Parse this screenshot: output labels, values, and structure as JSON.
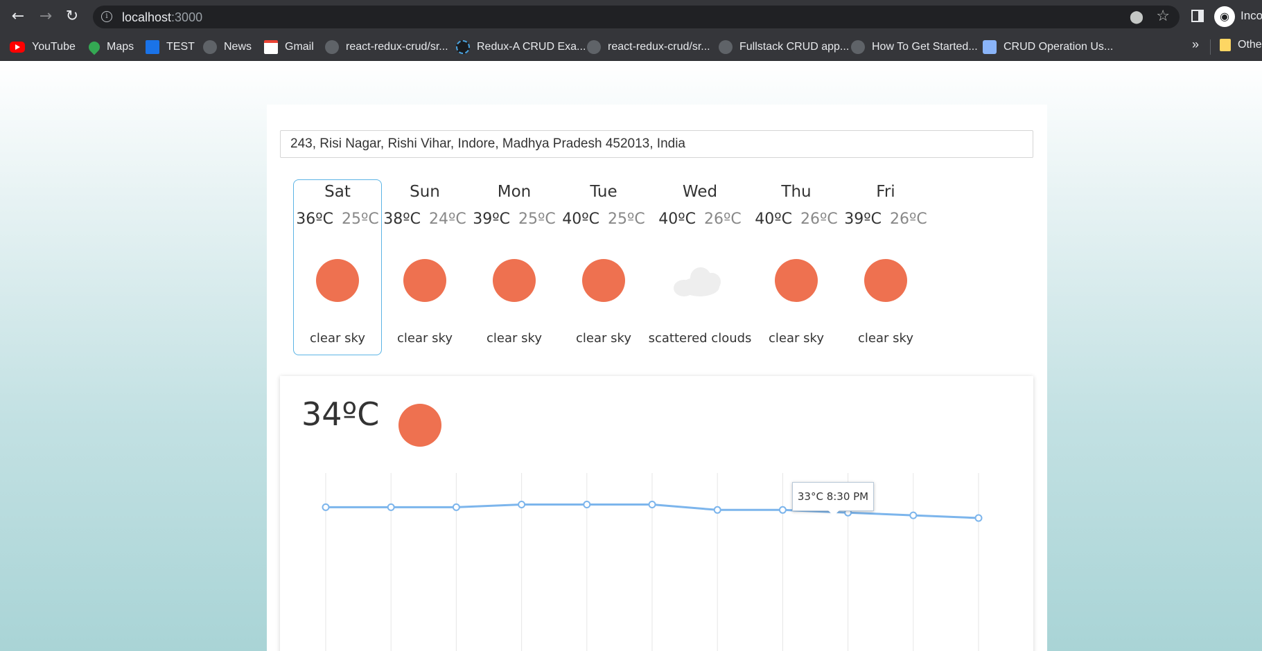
{
  "browser": {
    "url_host": "localhost",
    "url_port": ":3000",
    "profile_label": "Incognito",
    "bookmarks": [
      {
        "label": "YouTube",
        "icon": "youtube-icon"
      },
      {
        "label": "Maps",
        "icon": "maps-icon"
      },
      {
        "label": "TEST",
        "icon": "sxm-icon"
      },
      {
        "label": "News",
        "icon": "globe-icon"
      },
      {
        "label": "Gmail",
        "icon": "gmail-icon"
      },
      {
        "label": "react-redux-crud/sr...",
        "icon": "globe-icon"
      },
      {
        "label": "Redux-A CRUD Exa...",
        "icon": "redux-icon"
      },
      {
        "label": "react-redux-crud/sr...",
        "icon": "globe-icon"
      },
      {
        "label": "Fullstack CRUD app...",
        "icon": "globe-icon"
      },
      {
        "label": "How To Get Started...",
        "icon": "globe-icon"
      },
      {
        "label": "CRUD Operation Us...",
        "icon": "crud-icon"
      }
    ],
    "overflow_label": "»",
    "other_folder_label": "Other bookmarks"
  },
  "weather": {
    "location": "243, Risi Nagar, Rishi Vihar, Indore, Madhya Pradesh 452013, India",
    "days": [
      {
        "name": "Sat",
        "max": "36ºC",
        "min": "25ºC",
        "icon": "sun-icon",
        "desc": "clear sky",
        "selected": true
      },
      {
        "name": "Sun",
        "max": "38ºC",
        "min": "24ºC",
        "icon": "sun-icon",
        "desc": "clear sky"
      },
      {
        "name": "Mon",
        "max": "39ºC",
        "min": "25ºC",
        "icon": "sun-icon",
        "desc": "clear sky"
      },
      {
        "name": "Tue",
        "max": "40ºC",
        "min": "25ºC",
        "icon": "sun-icon",
        "desc": "clear sky"
      },
      {
        "name": "Wed",
        "max": "40ºC",
        "min": "26ºC",
        "icon": "cloud-icon",
        "desc": "scattered clouds"
      },
      {
        "name": "Thu",
        "max": "40ºC",
        "min": "26ºC",
        "icon": "sun-icon",
        "desc": "clear sky"
      },
      {
        "name": "Fri",
        "max": "39ºC",
        "min": "26ºC",
        "icon": "sun-icon",
        "desc": "clear sky"
      }
    ],
    "current_temp": "34ºC",
    "current_icon": "sun-icon",
    "tooltip": "33°C 8:30 PM",
    "colors": {
      "sun": "#ee7150",
      "line": "#7cb5ec",
      "selected_border": "#5bb4e5"
    }
  },
  "chart_data": {
    "type": "line",
    "title": "",
    "xlabel": "",
    "ylabel": "",
    "values": [
      34,
      34,
      34,
      35,
      35,
      35,
      33,
      33,
      32,
      31,
      30
    ],
    "ylim": [
      20,
      40
    ],
    "grid": "vertical",
    "legend": "none",
    "highlighted_point": 7
  }
}
